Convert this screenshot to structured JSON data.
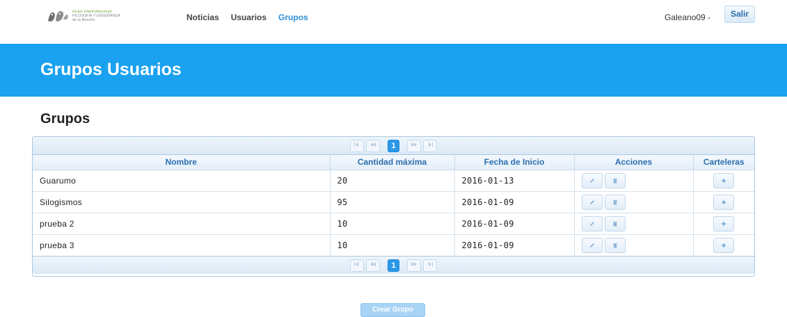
{
  "navbar": {
    "logo_lines": [
      "Grupo Interinstitucional",
      "FILOSOFÍA Y ENSEÑANZA",
      "de la filosofía"
    ],
    "links": [
      {
        "label": "Noticias",
        "active": false
      },
      {
        "label": "Usuarios",
        "active": false
      },
      {
        "label": "Grupos",
        "active": true
      }
    ],
    "user": "Galeano09 -",
    "logout_label": "Salir"
  },
  "banner": {
    "title": "Grupos Usuarios"
  },
  "section": {
    "title": "Grupos"
  },
  "table": {
    "columns": [
      "Nombre",
      "Cantidad máxima",
      "Fecha de Inicio",
      "Acciones",
      "Carteleras"
    ],
    "rows": [
      {
        "nombre": "Guarumo",
        "cantidad": "20",
        "fecha": "2016-01-13"
      },
      {
        "nombre": "Silogismos",
        "cantidad": "95",
        "fecha": "2016-01-09"
      },
      {
        "nombre": "prueba 2",
        "cantidad": "10",
        "fecha": "2016-01-09"
      },
      {
        "nombre": "prueba 3",
        "cantidad": "10",
        "fecha": "2016-01-09"
      }
    ],
    "paginator": {
      "current_page": "1",
      "first_icon": "first-page-icon",
      "prev_icon": "prev-page-icon",
      "next_icon": "next-page-icon",
      "last_icon": "last-page-icon"
    },
    "action_icons": [
      "pencil-icon",
      "trash-icon"
    ],
    "cartelera_icon": "plus-icon"
  },
  "create_button_label": "Crear Grupo",
  "colors": {
    "banner": "#1aa1f0",
    "active_link": "#2b8fd6",
    "header_text": "#2b6fb0",
    "current_page": "#2b98e8",
    "create_button": "#a8d4f5"
  }
}
